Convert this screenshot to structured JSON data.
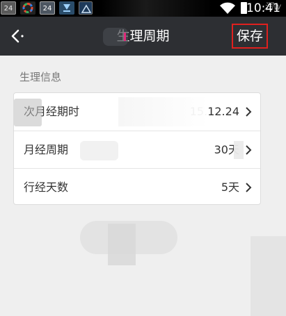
{
  "status_bar": {
    "notif_icons": [
      "24",
      "",
      "24",
      "",
      ""
    ],
    "time": "10:41",
    "watermark": "润w"
  },
  "header": {
    "title": "生理周期",
    "save_label": "保存"
  },
  "section": {
    "title": "生理信息"
  },
  "rows": [
    {
      "label": "次月经期时",
      "value": "15.12.24"
    },
    {
      "label": "月经周期",
      "value": "30天"
    },
    {
      "label": "行经天数",
      "value": "5天"
    }
  ],
  "colors": {
    "title_bar": "#2d2f33",
    "save_highlight": "#e0201e",
    "background": "#efefef"
  }
}
